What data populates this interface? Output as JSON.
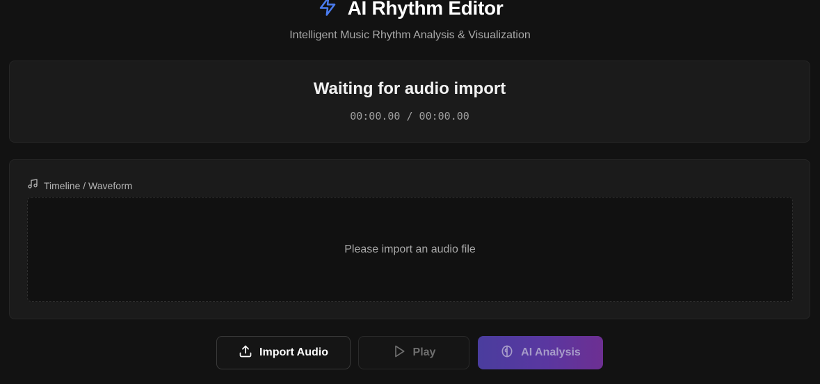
{
  "header": {
    "icon": "lightning-bolt-icon",
    "title": "AI Rhythm Editor",
    "subtitle": "Intelligent Music Rhythm Analysis & Visualization",
    "accent_color": "#4a7cf0"
  },
  "status": {
    "message": "Waiting for audio import",
    "current_time": "00:00.00",
    "separator": "/",
    "total_time": "00:00.00"
  },
  "timeline": {
    "icon": "music-note-icon",
    "label": "Timeline / Waveform",
    "placeholder": "Please import an audio file"
  },
  "controls": {
    "import": {
      "label": "Import Audio",
      "icon": "upload-icon"
    },
    "play": {
      "label": "Play",
      "icon": "play-icon",
      "disabled": true
    },
    "ai_analysis": {
      "label": "AI Analysis",
      "icon": "brain-icon",
      "disabled": true
    }
  }
}
